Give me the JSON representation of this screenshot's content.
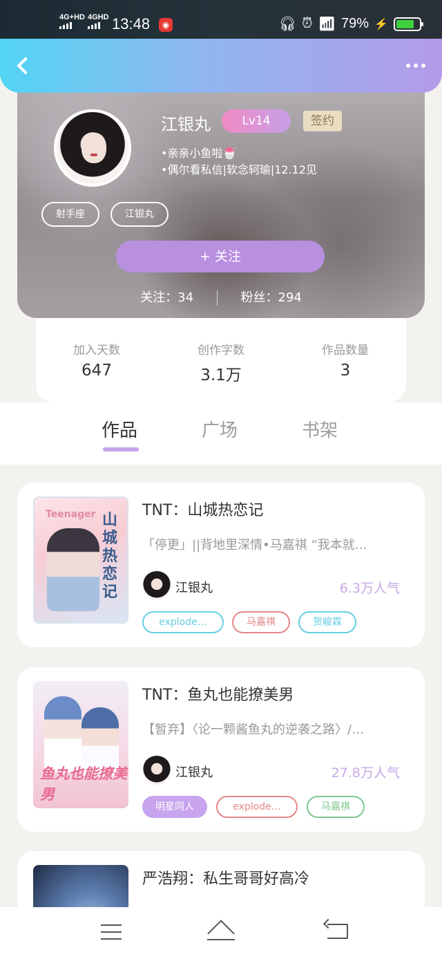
{
  "status_bar": {
    "signal_1": "4G+HD",
    "signal_2": "4GHD",
    "time": "13:48",
    "battery": "79%",
    "battery_level": 0.79
  },
  "header": {
    "back_icon": "chevron-left-icon",
    "more_icon": "more-dots-icon"
  },
  "profile": {
    "name": "江银丸",
    "level": "Lv14",
    "sign_badge": "签约",
    "bio_1": "•亲亲小鱼啦🍧",
    "bio_2": "•偶尔看私信|软念轲瑜|12.12见",
    "tags": [
      "射手座",
      "江银丸"
    ],
    "follow_button": "+  关注",
    "following": "关注：34",
    "fans": "粉丝：294"
  },
  "stats": [
    {
      "label": "加入天数",
      "value": "647"
    },
    {
      "label": "创作字数",
      "value": "3.1万"
    },
    {
      "label": "作品数量",
      "value": "3"
    }
  ],
  "tabs": [
    {
      "label": "作品"
    },
    {
      "label": "广场"
    },
    {
      "label": "书架"
    }
  ],
  "works": [
    {
      "title": "TNT：山城热恋记",
      "desc": "「停更」||背地里深情•马嘉祺 “我本就…",
      "author": "江银丸",
      "popularity": "6.3万人气",
      "cover_title": "山城热恋记",
      "cover_en": "Teenager",
      "tags": [
        "explode…",
        "马嘉祺",
        "贺峻霖"
      ]
    },
    {
      "title": "TNT：鱼丸也能撩美男",
      "desc": "【暂弃】〈论一颗酱鱼丸的逆袭之路〉/…",
      "author": "江银丸",
      "popularity": "27.8万人气",
      "cover_title": "鱼丸也能撩美男",
      "tags": [
        "明星同人",
        "explode…",
        "马嘉祺"
      ]
    },
    {
      "title": "严浩翔：私生哥哥好高冷",
      "desc": ""
    }
  ]
}
